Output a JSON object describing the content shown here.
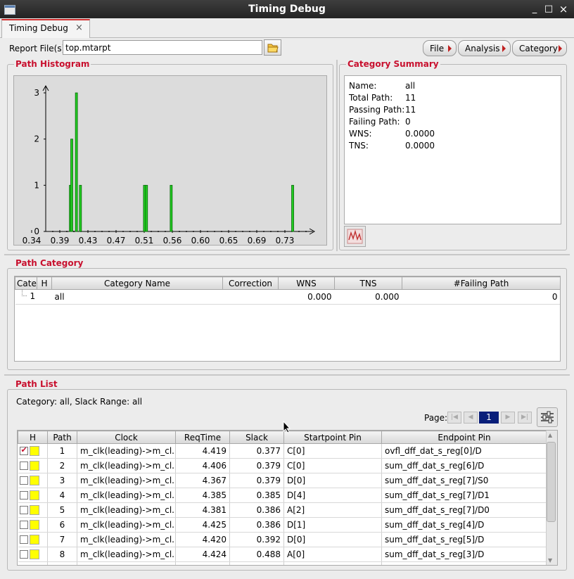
{
  "window": {
    "title": "Timing Debug",
    "minimize": "_",
    "maximize": "□",
    "close": "×"
  },
  "tab": {
    "label": "Timing Debug",
    "close": "×"
  },
  "report": {
    "label": "Report File(s)",
    "value": "top.mtarpt"
  },
  "menus": [
    "File",
    "Analysis",
    "Category"
  ],
  "histogram": {
    "title": "Path Histogram",
    "chart_data": {
      "type": "bar",
      "x_ticks": [
        "0.34",
        "0.39",
        "0.43",
        "0.47",
        "0.51",
        "0.56",
        "0.60",
        "0.65",
        "0.69",
        "0.73"
      ],
      "y_ticks": [
        "0",
        "1",
        "2",
        "3"
      ],
      "xlim": [
        0.34,
        0.73
      ],
      "ylim": [
        0,
        3
      ],
      "bars": [
        {
          "x": 0.377,
          "y": 1
        },
        {
          "x": 0.379,
          "y": 2
        },
        {
          "x": 0.386,
          "y": 3
        },
        {
          "x": 0.392,
          "y": 1
        },
        {
          "x": 0.488,
          "y": 1
        },
        {
          "x": 0.491,
          "y": 1
        },
        {
          "x": 0.528,
          "y": 1
        },
        {
          "x": 0.71,
          "y": 1
        }
      ],
      "bar_color": "#22cc22"
    }
  },
  "summary": {
    "title": "Category Summary",
    "rows": [
      {
        "label": "Name:",
        "value": "all"
      },
      {
        "label": "Total Path:",
        "value": "11"
      },
      {
        "label": "Passing Path:",
        "value": "11"
      },
      {
        "label": "Failing Path:",
        "value": "0"
      },
      {
        "label": "WNS:",
        "value": "0.0000"
      },
      {
        "label": "TNS:",
        "value": "0.0000"
      }
    ]
  },
  "path_category": {
    "title": "Path Category",
    "headers": [
      "Cate",
      "H",
      "Category Name",
      "Correction",
      "WNS",
      "TNS",
      "#Failing Path"
    ],
    "rows": [
      {
        "cate": "1",
        "h": "",
        "name": "all",
        "correction": "",
        "wns": "0.000",
        "tns": "0.000",
        "failing": "0"
      }
    ]
  },
  "path_list": {
    "title": "Path List",
    "filter_text": "Category: all,  Slack Range: all",
    "page_label": "Page:",
    "page": "1",
    "headers": [
      "H",
      "Path",
      "Clock",
      "ReqTime",
      "Slack",
      "Startpoint Pin",
      "Endpoint Pin"
    ],
    "rows": [
      {
        "checked": true,
        "path": "1",
        "clock": "m_clk(leading)->m_cl...",
        "req": "4.419",
        "slack": "0.377",
        "start": "C[0]",
        "end": "ovfl_dff_dat_s_reg[0]/D"
      },
      {
        "checked": false,
        "path": "2",
        "clock": "m_clk(leading)->m_cl...",
        "req": "4.406",
        "slack": "0.379",
        "start": "C[0]",
        "end": "sum_dff_dat_s_reg[6]/D"
      },
      {
        "checked": false,
        "path": "3",
        "clock": "m_clk(leading)->m_cl...",
        "req": "4.367",
        "slack": "0.379",
        "start": "D[0]",
        "end": "sum_dff_dat_s_reg[7]/S0"
      },
      {
        "checked": false,
        "path": "4",
        "clock": "m_clk(leading)->m_cl...",
        "req": "4.385",
        "slack": "0.385",
        "start": "D[4]",
        "end": "sum_dff_dat_s_reg[7]/D1"
      },
      {
        "checked": false,
        "path": "5",
        "clock": "m_clk(leading)->m_cl...",
        "req": "4.381",
        "slack": "0.386",
        "start": "A[2]",
        "end": "sum_dff_dat_s_reg[7]/D0"
      },
      {
        "checked": false,
        "path": "6",
        "clock": "m_clk(leading)->m_cl...",
        "req": "4.425",
        "slack": "0.386",
        "start": "D[1]",
        "end": "sum_dff_dat_s_reg[4]/D"
      },
      {
        "checked": false,
        "path": "7",
        "clock": "m_clk(leading)->m_cl...",
        "req": "4.420",
        "slack": "0.392",
        "start": "D[0]",
        "end": "sum_dff_dat_s_reg[5]/D"
      },
      {
        "checked": false,
        "path": "8",
        "clock": "m_clk(leading)->m_cl...",
        "req": "4.424",
        "slack": "0.488",
        "start": "A[0]",
        "end": "sum_dff_dat_s_reg[3]/D"
      }
    ]
  },
  "colors": {
    "accent": "#c8102e",
    "bar": "#22cc22",
    "highlight": "#ffff00",
    "page_bg": "#0a1f7a"
  }
}
